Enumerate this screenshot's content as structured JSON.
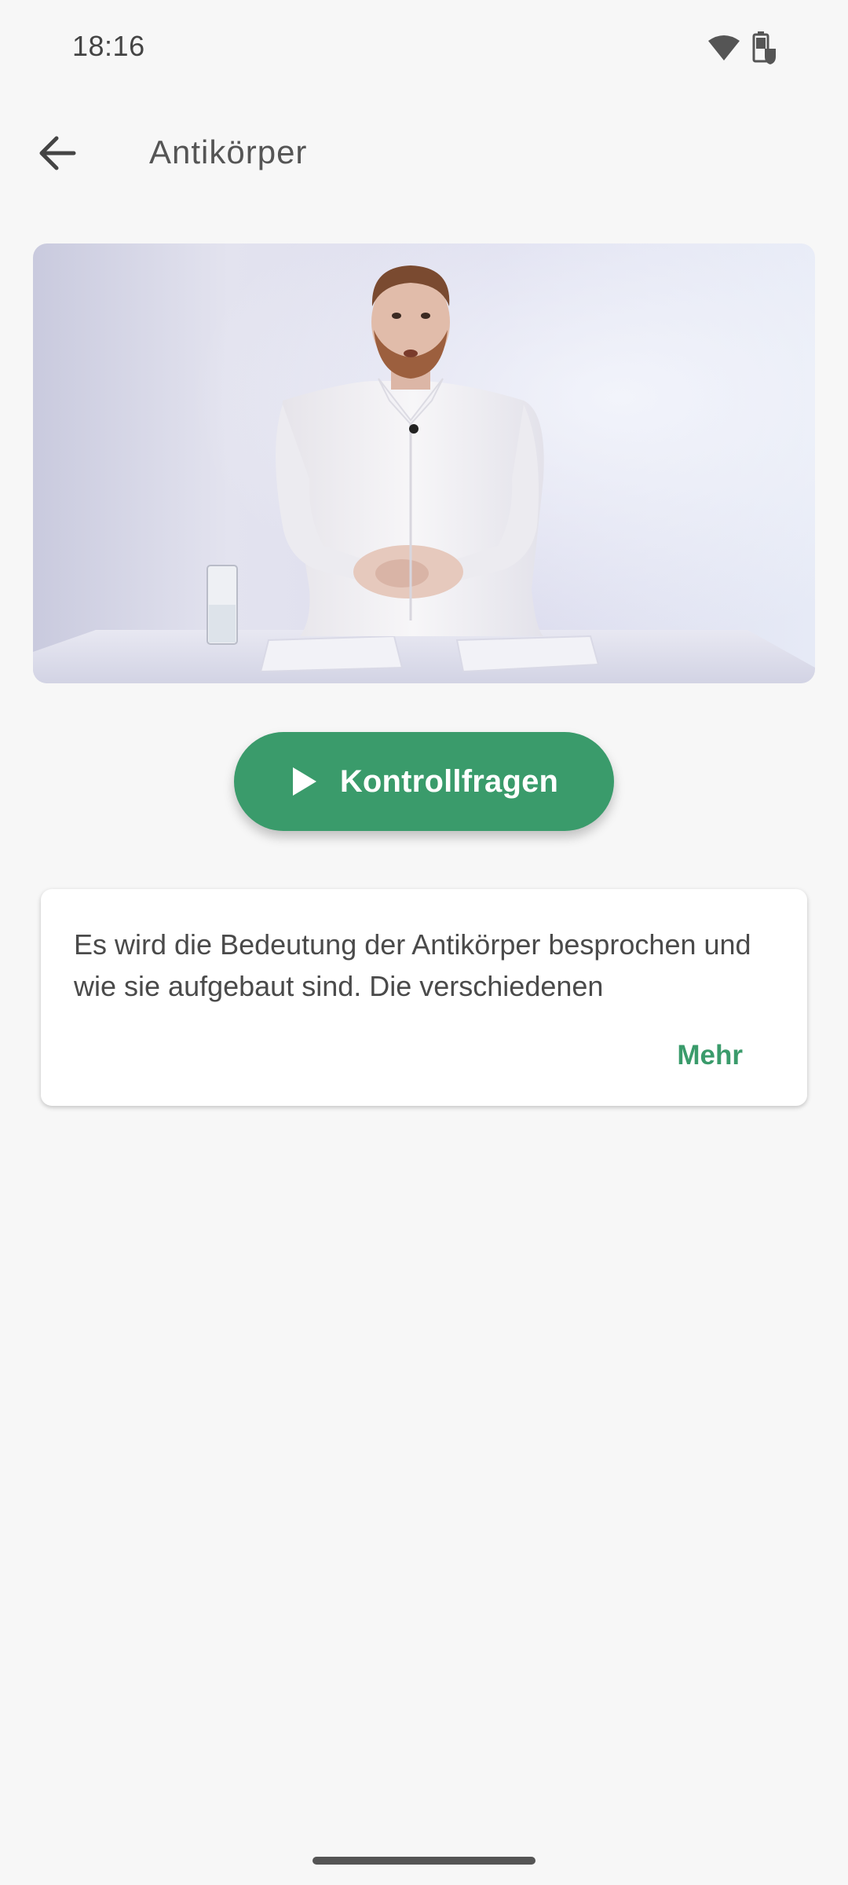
{
  "status_bar": {
    "time": "18:16",
    "icons": [
      "wifi-icon",
      "battery-saver-icon"
    ]
  },
  "app_bar": {
    "back_icon": "arrow-left-icon",
    "title": "Antikörper"
  },
  "video": {
    "thumbnail": "presenter-video-thumbnail"
  },
  "quiz_button": {
    "icon": "play-icon",
    "label": "Kontrollfragen"
  },
  "description_card": {
    "text": "Es wird die Bedeutung der Antikörper besprochen und wie sie aufgebaut sind. Die verschiedenen",
    "more_label": "Mehr"
  },
  "colors": {
    "accent": "#3a9b6b",
    "background": "#f7f7f7",
    "card": "#ffffff",
    "text": "#4a4a4a"
  }
}
